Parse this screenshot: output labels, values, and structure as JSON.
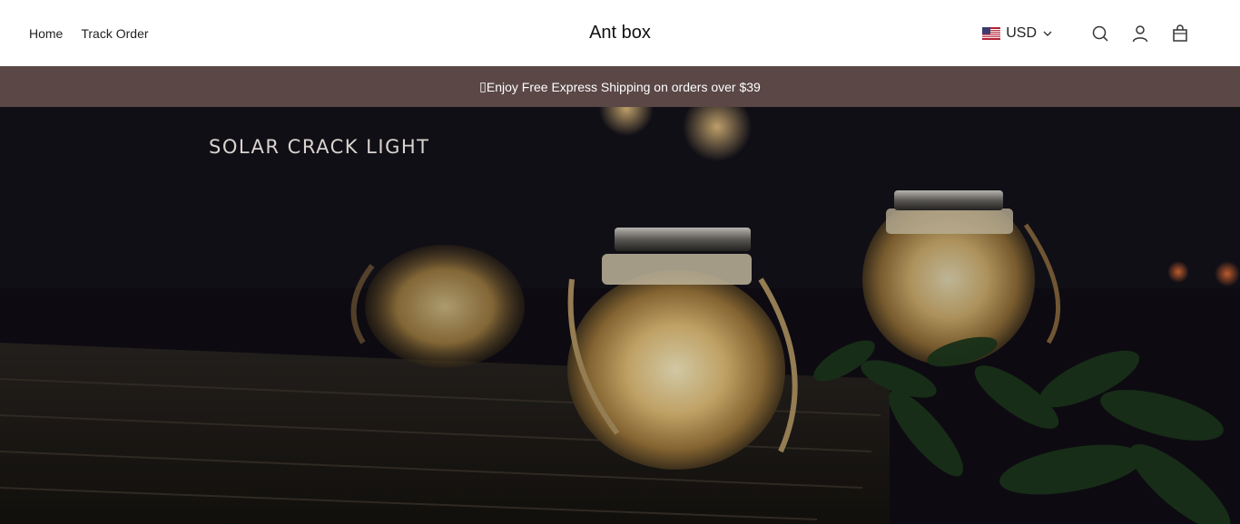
{
  "header": {
    "nav": [
      {
        "label": "Home"
      },
      {
        "label": "Track Order"
      }
    ],
    "brand": "Ant box",
    "currency": {
      "code": "USD",
      "flag_icon": "us-flag-icon"
    },
    "icons": [
      "search-icon",
      "account-icon",
      "cart-icon"
    ]
  },
  "announcement": {
    "text": "Enjoy Free Express Shipping on orders over $39",
    "prefix_glyph": "▯"
  },
  "hero": {
    "title": "SOLAR CRACK LIGHT"
  },
  "colors": {
    "announcement_bg": "#5a4746",
    "header_bg": "#ffffff",
    "hero_overlay": "#0d0c12"
  }
}
